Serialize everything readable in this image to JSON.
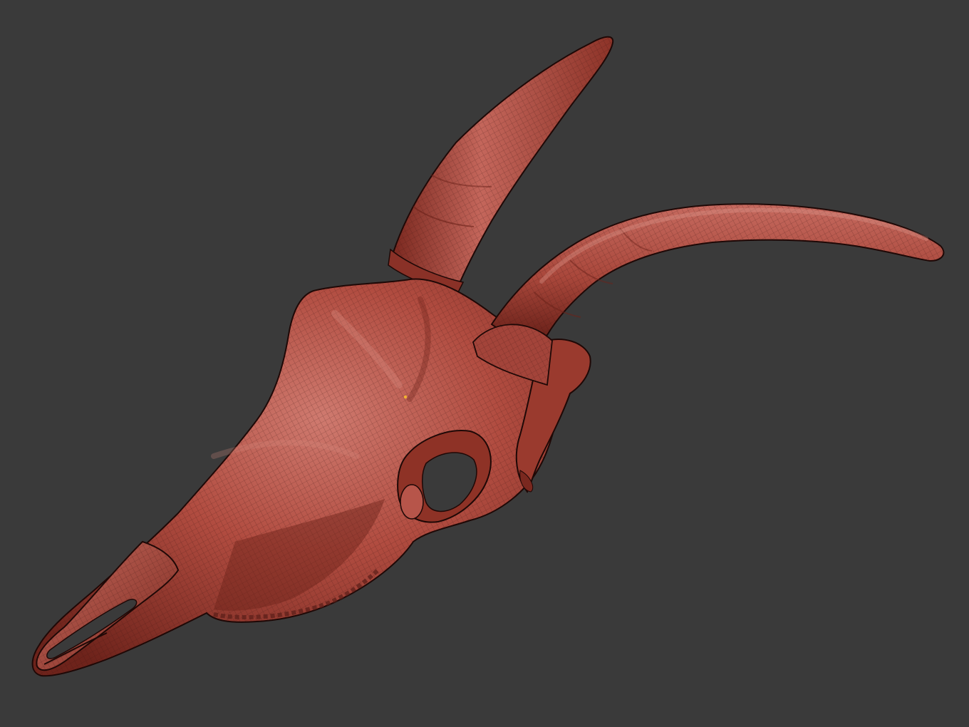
{
  "viewport": {
    "background_color": "#3a3a3a",
    "model": {
      "subject": "skull-with-horns",
      "material_color": "#b14c40",
      "shadow_color": "#5a1e18",
      "highlight_color": "#d7847a",
      "wireframe_visible": true,
      "wireframe_color": "#3b1410"
    }
  }
}
